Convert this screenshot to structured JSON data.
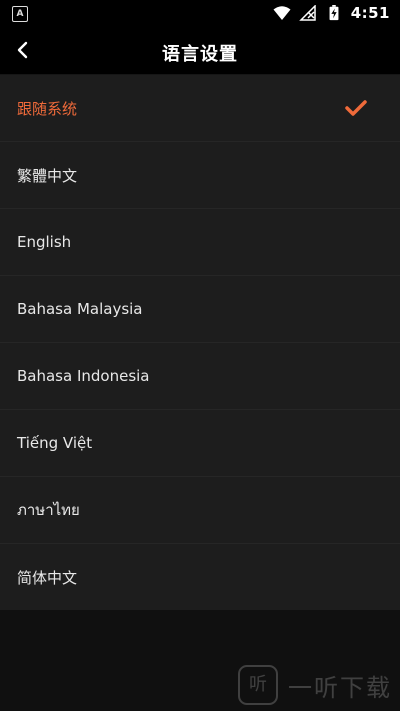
{
  "status_bar": {
    "left_icon": "A",
    "time": "4:51",
    "icons": [
      "wifi-icon",
      "signal-off-icon",
      "battery-charging-icon"
    ]
  },
  "header": {
    "title": "语言设置",
    "back_icon": "chevron-left-icon"
  },
  "languages": [
    {
      "label": "跟随系统",
      "selected": true
    },
    {
      "label": "繁體中文",
      "selected": false
    },
    {
      "label": "English",
      "selected": false
    },
    {
      "label": "Bahasa Malaysia",
      "selected": false
    },
    {
      "label": "Bahasa Indonesia",
      "selected": false
    },
    {
      "label": "Tiếng Việt",
      "selected": false
    },
    {
      "label": "ภาษาไทย",
      "selected": false
    },
    {
      "label": "简体中文",
      "selected": false
    }
  ],
  "colors": {
    "accent": "#ef6a3a",
    "background": "#101010",
    "list_bg": "#1d1d1d",
    "header_bg": "#000000"
  },
  "watermark": {
    "logo_text": "听",
    "text": "一听下载"
  }
}
